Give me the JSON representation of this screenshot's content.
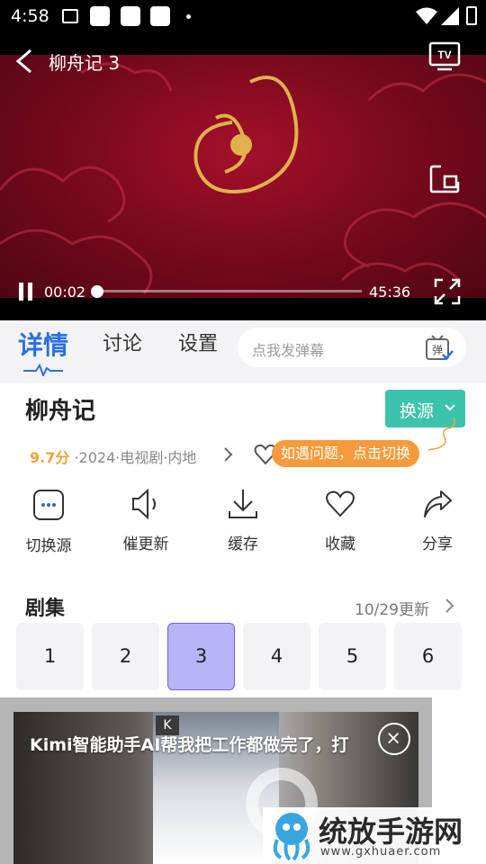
{
  "status_bar": {
    "time": "4:58"
  },
  "player": {
    "title": "柳舟记 3",
    "current_time": "00:02",
    "duration": "45:36",
    "progress_fraction": 0.0007,
    "cast_label": "TV"
  },
  "tabs": [
    {
      "label": "详情",
      "active": true
    },
    {
      "label": "讨论",
      "active": false
    },
    {
      "label": "设置",
      "active": false
    }
  ],
  "danmaku": {
    "placeholder": "点我发弹幕",
    "icon_label": "弹"
  },
  "show": {
    "title": "柳舟记",
    "switch_source": "换源",
    "score": "9.7分",
    "meta": " ·2024·电视剧·内地",
    "tip": "如遇问题，点击切换"
  },
  "actions": [
    {
      "label": "切换源",
      "icon": "more-dots-icon"
    },
    {
      "label": "催更新",
      "icon": "speaker-icon"
    },
    {
      "label": "缓存",
      "icon": "download-icon"
    },
    {
      "label": "收藏",
      "icon": "heart-icon"
    },
    {
      "label": "分享",
      "icon": "share-icon"
    }
  ],
  "episodes": {
    "heading": "剧集",
    "update": "10/29更新",
    "items": [
      "1",
      "2",
      "3",
      "4",
      "5",
      "6"
    ],
    "selected": "3"
  },
  "ad": {
    "text": "Kimi智能助手AI帮我把工作都做完了，打",
    "badge": "K"
  },
  "watermark": {
    "name": "统放手游网",
    "url": "www.gxhuaer.com"
  },
  "colors": {
    "accent_blue": "#2a6fe6",
    "switch_green": "#3cc3ac",
    "score_orange": "#f2a33a",
    "selected_episode": "#b7b4f7"
  }
}
